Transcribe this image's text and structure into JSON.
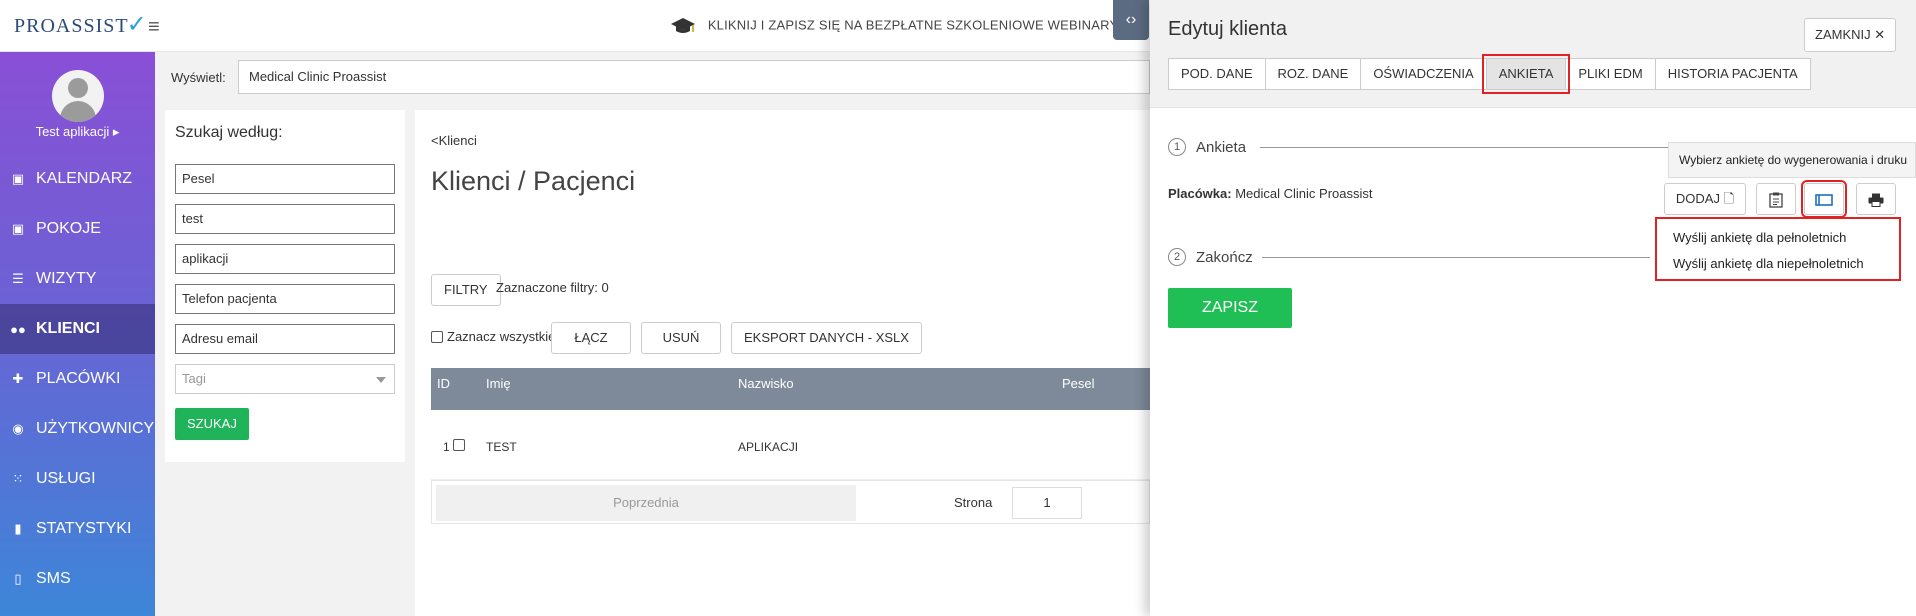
{
  "topbar": {
    "logo": "PROASSIST",
    "promo": "KLIKNIJ I ZAPISZ SIĘ NA BEZPŁATNE SZKOLENIOWE WEBINARY",
    "toggle_icon": "‹›"
  },
  "sidebar": {
    "user": "Test aplikacji ▸",
    "items": [
      {
        "label": "KALENDARZ",
        "icon": "calendar-icon"
      },
      {
        "label": "POKOJE",
        "icon": "calendar-icon"
      },
      {
        "label": "WIZYTY",
        "icon": "list-icon"
      },
      {
        "label": "KLIENCI",
        "icon": "users-icon"
      },
      {
        "label": "PLACÓWKI",
        "icon": "add-user-icon"
      },
      {
        "label": "UŻYTKOWNICY",
        "icon": "user-circle-icon"
      },
      {
        "label": "USŁUGI",
        "icon": "grid-icon"
      },
      {
        "label": "STATYSTYKI",
        "icon": "bar-chart-icon"
      },
      {
        "label": "SMS",
        "icon": "phone-icon"
      }
    ]
  },
  "main": {
    "display_label": "Wyświetl:",
    "display_value": "Medical Clinic Proassist",
    "search": {
      "title": "Szukaj według:",
      "fields": [
        "Pesel",
        "test",
        "aplikacji",
        "Telefon pacjenta",
        "Adresu email"
      ],
      "tags_placeholder": "Tagi",
      "button": "SZUKAJ"
    },
    "list": {
      "breadcrumb": "<Klienci",
      "title": "Klienci / Pacjenci",
      "filters_button": "FILTRY",
      "filters_info": "Zaznaczone filtry: 0",
      "select_all": "Zaznacz wszystkie",
      "merge": "ŁĄCZ",
      "delete": "USUŃ",
      "export": "EKSPORT DANYCH - XSLX",
      "columns": [
        "ID",
        "Imię",
        "Nazwisko",
        "Pesel"
      ],
      "row": {
        "id": "1",
        "first": "TEST",
        "last": "APLIKACJI"
      },
      "prev": "Poprzednia",
      "page_label": "Strona",
      "page": "1"
    }
  },
  "panel": {
    "title": "Edytuj klienta",
    "close": "ZAMKNIJ ✕",
    "tabs": [
      "POD. DANE",
      "ROZ. DANE",
      "OŚWIADCZENIA",
      "ANKIETA",
      "PLIKI EDM",
      "HISTORIA PACJENTA"
    ],
    "step1": "Ankieta",
    "step1_num": "1",
    "step2": "Zakończ",
    "step2_num": "2",
    "placowka_label": "Placówka:",
    "placowka_value": "Medical Clinic Proassist",
    "tooltip": "Wybierz ankietę do wygenerowania i druku",
    "add": "DODAJ",
    "dropdown": [
      "Wyślij ankietę dla pełnoletnich",
      "Wyślij ankietę dla niepełnoletnich"
    ],
    "save": "ZAPISZ"
  }
}
